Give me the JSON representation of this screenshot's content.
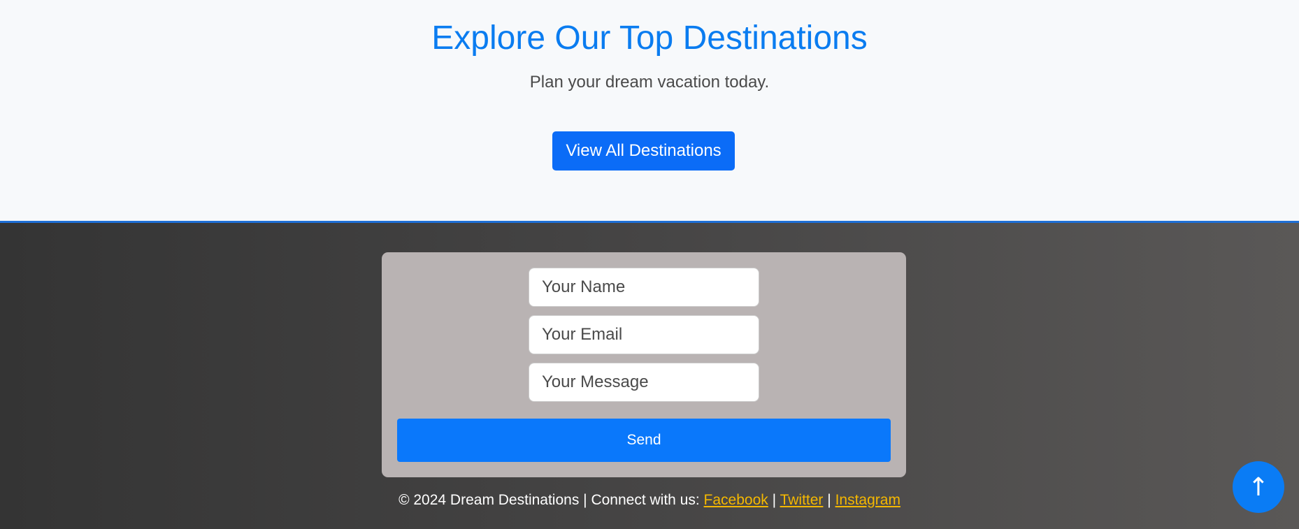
{
  "hero": {
    "title": "Explore Our Top Destinations",
    "subtitle": "Plan your dream vacation today.",
    "cta_label": "View All Destinations"
  },
  "contact_form": {
    "name_placeholder": "Your Name",
    "email_placeholder": "Your Email",
    "message_placeholder": "Your Message",
    "send_label": "Send"
  },
  "footer": {
    "copyright": "© 2024 Dream Destinations | Connect with us:",
    "separator": "|",
    "links": [
      "Facebook",
      "Twitter",
      "Instagram"
    ]
  },
  "scroll_top": {
    "icon": "arrow-up-icon",
    "glyph": "↑"
  },
  "colors": {
    "accent": "#0a7cf0",
    "button": "#0b6cf7",
    "link": "#f5b800",
    "card": "#b9b3b3"
  }
}
